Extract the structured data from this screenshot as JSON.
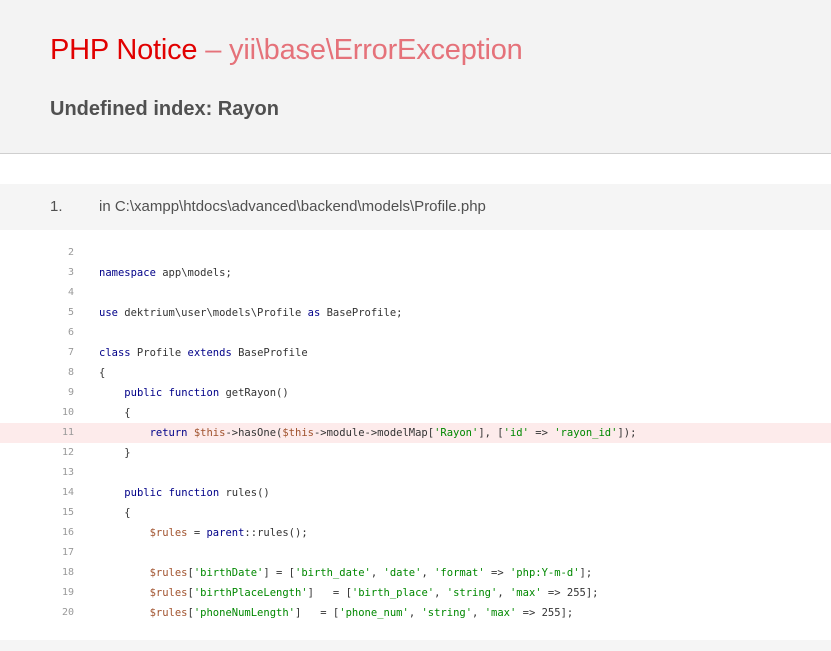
{
  "header": {
    "notice_label": "PHP Notice",
    "dash": " – ",
    "exception_class": "yii\\base\\ErrorException",
    "message": "Undefined index: Rayon"
  },
  "call_stack": {
    "item_number": "1.",
    "file_text": "in C:\\xampp\\htdocs\\advanced\\backend\\models\\Profile.php"
  },
  "code": {
    "error_line": "11",
    "lines": [
      {
        "n": "2"
      },
      {
        "n": "3"
      },
      {
        "n": "4"
      },
      {
        "n": "5"
      },
      {
        "n": "6"
      },
      {
        "n": "7"
      },
      {
        "n": "8"
      },
      {
        "n": "9"
      },
      {
        "n": "10"
      },
      {
        "n": "11"
      },
      {
        "n": "12"
      },
      {
        "n": "13"
      },
      {
        "n": "14"
      },
      {
        "n": "15"
      },
      {
        "n": "16"
      },
      {
        "n": "17"
      },
      {
        "n": "18"
      },
      {
        "n": "19"
      },
      {
        "n": "20"
      }
    ],
    "text": {
      "l3_kw": "namespace",
      "l3_rest": " app\\models;",
      "l5_kw": "use",
      "l5_rest": " dektrium\\user\\models\\Profile ",
      "l5_as": "as",
      "l5_end": " BaseProfile;",
      "l7_kw1": "class",
      "l7_mid": " Profile ",
      "l7_kw2": "extends",
      "l7_end": " BaseProfile",
      "l8": "{",
      "l9_kw1": "public",
      "l9_kw2": "function",
      "l9_rest": " getRayon()",
      "l10": "{",
      "l11_kw": "return",
      "l11_this1": "$this",
      "l11_a": "->hasOne(",
      "l11_this2": "$this",
      "l11_b": "->module->modelMap[",
      "l11_s1": "'Rayon'",
      "l11_c": "], [",
      "l11_s2": "'id'",
      "l11_d": " => ",
      "l11_s3": "'rayon_id'",
      "l11_e": "]);",
      "l12": "}",
      "l14_kw1": "public",
      "l14_kw2": "function",
      "l14_rest": " rules()",
      "l15": "{",
      "l16_var": "$rules",
      "l16_mid": " = ",
      "l16_kw": "parent",
      "l16_rest": "::rules();",
      "l18_var": "$rules",
      "l18_a": "[",
      "l18_s1": "'birthDate'",
      "l18_b": "] = [",
      "l18_s2": "'birth_date'",
      "l18_c": ", ",
      "l18_s3": "'date'",
      "l18_d": ", ",
      "l18_s4": "'format'",
      "l18_e": " => ",
      "l18_s5": "'php:Y-m-d'",
      "l18_f": "];",
      "l19_var": "$rules",
      "l19_a": "[",
      "l19_s1": "'birthPlaceLength'",
      "l19_b": "]   = [",
      "l19_s2": "'birth_place'",
      "l19_c": ", ",
      "l19_s3": "'string'",
      "l19_d": ", ",
      "l19_s4": "'max'",
      "l19_e": " => 255];",
      "l20_var": "$rules",
      "l20_a": "[",
      "l20_s1": "'phoneNumLength'",
      "l20_b": "]   = [",
      "l20_s2": "'phone_num'",
      "l20_c": ", ",
      "l20_s3": "'string'",
      "l20_d": ", ",
      "l20_s4": "'max'",
      "l20_e": " => 255];"
    }
  },
  "colors": {
    "title_red": "#e10000",
    "exception_pink": "#e5727a",
    "error_line_bg": "#fdebeb",
    "header_bg": "#f3f3f3"
  }
}
